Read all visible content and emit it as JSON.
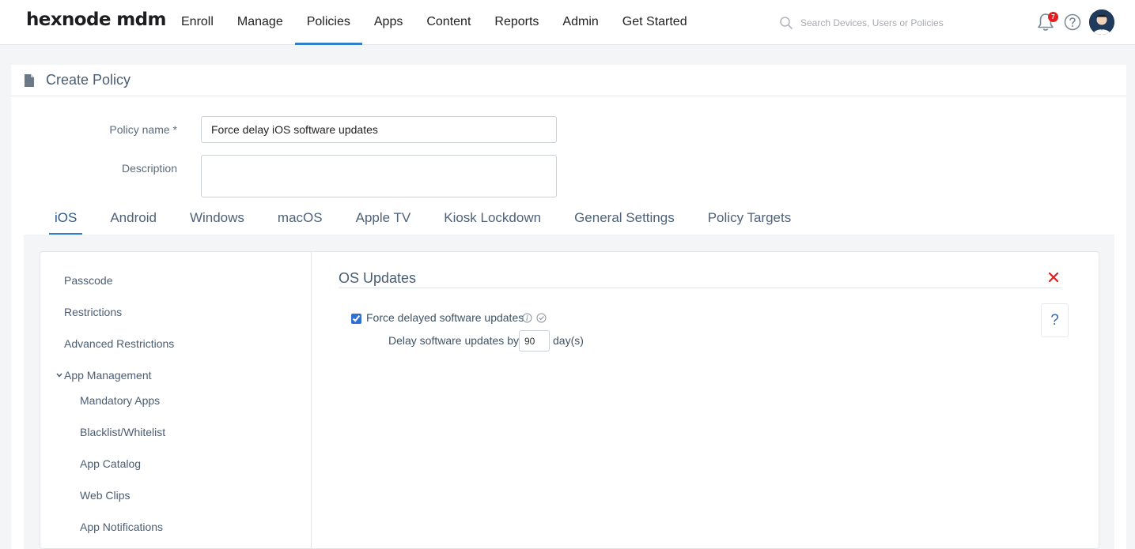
{
  "brand": {
    "logo": "hexnode mdm"
  },
  "nav": {
    "items": [
      {
        "label": "Enroll"
      },
      {
        "label": "Manage"
      },
      {
        "label": "Policies"
      },
      {
        "label": "Apps"
      },
      {
        "label": "Content"
      },
      {
        "label": "Reports"
      },
      {
        "label": "Admin"
      },
      {
        "label": "Get Started"
      }
    ],
    "active": "Policies"
  },
  "search": {
    "placeholder": "Search Devices, Users or Policies"
  },
  "notifications": {
    "count": "7"
  },
  "page": {
    "title": "Create Policy"
  },
  "form": {
    "policy_name_label": "Policy name *",
    "policy_name_value": "Force delay iOS software updates",
    "description_label": "Description",
    "description_value": ""
  },
  "platform_tabs": {
    "items": [
      "iOS",
      "Android",
      "Windows",
      "macOS",
      "Apple TV",
      "Kiosk Lockdown",
      "General Settings",
      "Policy Targets"
    ],
    "active": "iOS"
  },
  "side_menu": {
    "passcode": "Passcode",
    "restrictions": "Restrictions",
    "advanced_restrictions": "Advanced Restrictions",
    "app_management": "App Management",
    "mandatory_apps": "Mandatory Apps",
    "blacklist_whitelist": "Blacklist/Whitelist",
    "app_catalog": "App Catalog",
    "web_clips": "Web Clips",
    "app_notifications": "App Notifications"
  },
  "os_updates": {
    "title": "OS Updates",
    "force_delay_label": "Force delayed software updates",
    "force_delay_checked": true,
    "delay_label": "Delay software updates by",
    "delay_value": "90",
    "delay_unit": "day(s)",
    "help_label": "?"
  },
  "colors": {
    "accent": "#2f80c9",
    "close": "#e02020",
    "text_muted": "#4a5d73"
  }
}
